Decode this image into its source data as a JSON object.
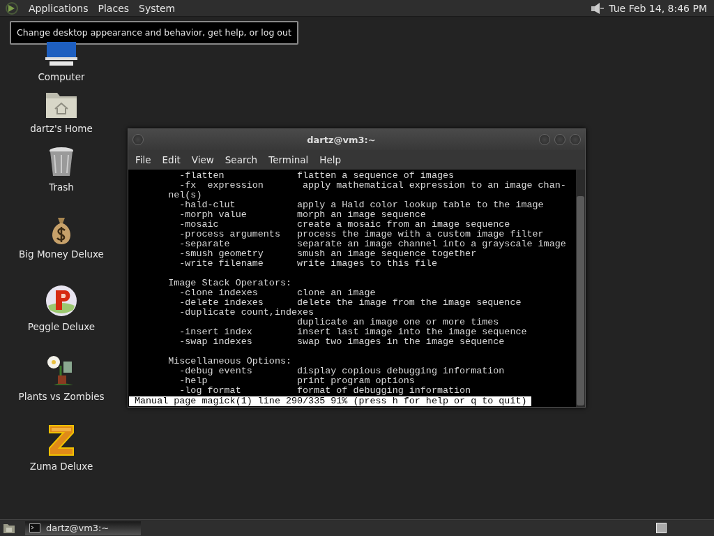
{
  "top_panel": {
    "menus": [
      {
        "label": "Applications"
      },
      {
        "label": "Places"
      },
      {
        "label": "System"
      }
    ],
    "clock": "Tue Feb 14,  8:46 PM"
  },
  "tooltip": "Change desktop appearance and behavior, get help, or log out",
  "desktop_icons": [
    {
      "label": "Computer",
      "kind": "computer"
    },
    {
      "label": "dartz's Home",
      "kind": "home"
    },
    {
      "label": "Trash",
      "kind": "trash"
    },
    {
      "label": "Big Money Deluxe",
      "kind": "money"
    },
    {
      "label": "Peggle Deluxe",
      "kind": "peggle"
    },
    {
      "label": "Plants vs Zombies",
      "kind": "plants"
    },
    {
      "label": "Zuma Deluxe",
      "kind": "zuma"
    }
  ],
  "terminal": {
    "title": "dartz@vm3:~",
    "menu": [
      {
        "label": "File"
      },
      {
        "label": "Edit"
      },
      {
        "label": "View"
      },
      {
        "label": "Search"
      },
      {
        "label": "Terminal"
      },
      {
        "label": "Help"
      }
    ],
    "sections": [
      {
        "lines": [
          {
            "text": "        -flatten             flatten a sequence of images"
          },
          {
            "text": "        -fx  expression       apply mathematical expression to an image chan-"
          },
          {
            "text": "      nel(s)"
          },
          {
            "text": "        -hald-clut           apply a Hald color lookup table to the image"
          },
          {
            "text": "        -morph value         morph an image sequence"
          },
          {
            "text": "        -mosaic              create a mosaic from an image sequence"
          },
          {
            "text": "        -process arguments   process the image with a custom image filter"
          },
          {
            "text": "        -separate            separate an image channel into a grayscale image"
          },
          {
            "text": "        -smush geometry      smush an image sequence together"
          },
          {
            "text": "        -write filename      write images to this file"
          }
        ]
      },
      {
        "lines": [
          {
            "text": "      Image Stack Operators:"
          },
          {
            "text": "        -clone indexes       clone an image"
          },
          {
            "text": "        -delete indexes      delete the image from the image sequence"
          },
          {
            "text": "        -duplicate count,indexes"
          },
          {
            "text": "                             duplicate an image one or more times"
          },
          {
            "text": "        -insert index        insert last image into the image sequence"
          },
          {
            "text": "        -swap indexes        swap two images in the image sequence"
          }
        ]
      },
      {
        "lines": [
          {
            "text": "      Miscellaneous Options:"
          },
          {
            "text": "        -debug events        display copious debugging information"
          },
          {
            "text": "        -help                print program options"
          },
          {
            "text": "        -log format          format of debugging information"
          }
        ]
      }
    ],
    "status_line": "Manual page magick(1) line 290/335 91% (press h for help or q to quit)"
  },
  "taskbar": {
    "tasks": [
      {
        "label": "dartz@vm3:~",
        "selected": true
      }
    ]
  }
}
